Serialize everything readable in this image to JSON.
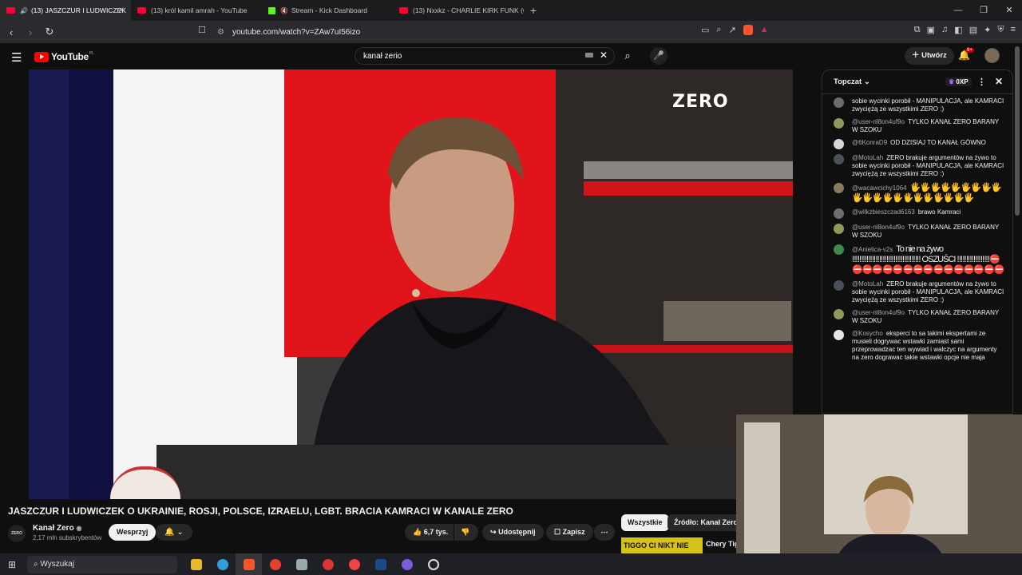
{
  "browser": {
    "tabs": [
      {
        "label": "(13) JASZCZUR I LUDWICZEK",
        "kind": "youtube",
        "active": true
      },
      {
        "label": "(13) król kamil amrah - YouTube",
        "kind": "youtube",
        "active": false
      },
      {
        "label": "Stream - Kick Dashboard",
        "kind": "kick",
        "active": false
      },
      {
        "label": "(13) Nxxkz - CHARLIE KIRK FUNK (OF",
        "kind": "youtube",
        "active": false
      }
    ],
    "url": "youtube.com/watch?v=ZAw7uI56izo"
  },
  "youtube": {
    "logo_text": "YouTube",
    "region": "PL",
    "search_value": "kanał zerio",
    "create_label": "Utwórz",
    "notif_count": "9+"
  },
  "video": {
    "overlay_logo": "ZERO",
    "title": "JASZCZUR I LUDWICZEK O UKRAINIE, ROSJI, POLSCE, IZRAELU, LGBT. BRACIA KAMRACI W KANALE ZERO",
    "channel_name": "Kanał Zero",
    "channel_avatar_text": "ZERO",
    "subscribers": "2,17 mln subskrybentów",
    "support_label": "Wesprzyj",
    "likes": "6,7 tys.",
    "share_label": "Udostępnij",
    "save_label": "Zapisz"
  },
  "chat": {
    "mode_label": "Topczat",
    "xp_label": "0XP",
    "messages": [
      {
        "author": "",
        "text": "sobie wycinki porobił - MANIPULACJA, ale KAMRACI zwyciężą ze wszystkimi ZERO :)",
        "avatar": "#6b6b6b"
      },
      {
        "author": "@user-nl8on4uf9o",
        "text": "TYLKO KANAŁ ZERO BARANY W SZOKU",
        "avatar": "#8c9a5b"
      },
      {
        "author": "@6KonraD9",
        "text": "OD DZISIAJ TO KANAŁ GÓWNO",
        "avatar": "#d7d7d7"
      },
      {
        "author": "@MotoLah",
        "text": "ZERO brakuje argumentów na żywo to sobie wycinki porobił - MANIPULACJA, ale KAMRACI zwyciężą ze wszystkimi ZERO :)",
        "avatar": "#4a4f5a"
      },
      {
        "author": "@wacawcichy1064",
        "text": "🖐🖐🖐🖐🖐🖐🖐🖐🖐🖐🖐🖐🖐🖐🖐🖐🖐🖐🖐🖐🖐",
        "avatar": "#8a7a5a",
        "emoji": true
      },
      {
        "author": "@wilkzbieszczad6163",
        "text": "brawo Kamraci",
        "avatar": "#6e6e6e"
      },
      {
        "author": "@user-nl8on4uf9o",
        "text": "TYLKO KANAŁ ZERO BARANY W SZOKU",
        "avatar": "#8c9a5b"
      },
      {
        "author": "@Anielica-v2s",
        "text": "To nie na żywo ‼‼‼‼‼‼‼‼‼‼‼‼‼‼‼‼‼‼‼ OSZUŚCI ‼‼‼‼‼‼‼‼‼⛔⛔⛔⛔⛔⛔⛔⛔⛔⛔⛔⛔⛔⛔⛔⛔",
        "avatar": "#3f8a4a",
        "emoji": true
      },
      {
        "author": "@MotoLah",
        "text": "ZERO brakuje argumentów na żywo to sobie wycinki porobił - MANIPULACJA, ale KAMRACI zwyciężą ze wszystkimi ZERO :)",
        "avatar": "#4a4f5a"
      },
      {
        "author": "@user-nl8on4uf9o",
        "text": "TYLKO KANAŁ ZERO BARANY W SZOKU",
        "avatar": "#8c9a5b"
      },
      {
        "author": "@Kosycho",
        "text": "eksperci to sa takimi ekspertami ze musieli dogrywac wstawki zamiast sami przeprowadzac ten wywiad i walczyc na argumenty na zero dograwac takie wstawki opcje nie maja",
        "avatar": "#e6e6e6"
      }
    ]
  },
  "chips": {
    "all": "Wszystkie",
    "source": "Źródło: Kanał Zero"
  },
  "related": {
    "thumb_text": "TIGGO CI NIKT NIE POWIE",
    "title": "Chery Tigg"
  },
  "taskbar": {
    "search_placeholder": "Wyszukaj"
  },
  "colors": {
    "accent_red": "#ff0000",
    "bg": "#0f0f0f",
    "chip_selected": "#f1f1f1"
  }
}
